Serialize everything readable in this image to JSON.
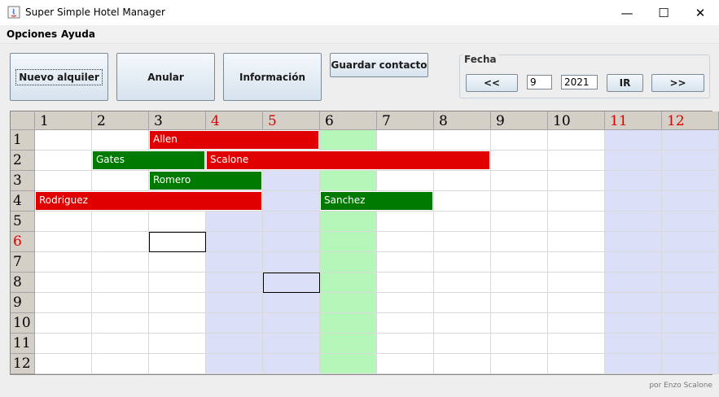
{
  "window": {
    "title": "Super Simple Hotel Manager",
    "minimize": "—",
    "maximize": "☐",
    "close": "✕"
  },
  "menu": {
    "items": [
      "Opciones",
      "Ayuda"
    ]
  },
  "toolbar": {
    "new_rental": "Nuevo alquiler",
    "cancel": "Anular",
    "info": "Información",
    "save_contact": "Guardar contacto"
  },
  "date": {
    "legend": "Fecha",
    "prev": "<<",
    "month": "9",
    "year": "2021",
    "go": "IR",
    "next": ">>"
  },
  "grid": {
    "days": [
      "1",
      "2",
      "3",
      "4",
      "5",
      "6",
      "7",
      "8",
      "9",
      "10",
      "11",
      "12"
    ],
    "weekend_days": [
      4,
      5,
      11,
      12
    ],
    "rooms": [
      "1",
      "2",
      "3",
      "4",
      "5",
      "6",
      "7",
      "8",
      "9",
      "10",
      "11",
      "12"
    ],
    "highlight_rooms": [
      6
    ],
    "today_day": 6,
    "colors": {
      "red": "#e00000",
      "green": "#007a00",
      "weekend": "#dcdff8",
      "today": "#b4f7b8",
      "header": "#d4d0c8"
    },
    "bookings": [
      {
        "room": 1,
        "start": 3,
        "end": 5,
        "name": "Allen",
        "color": "red"
      },
      {
        "room": 2,
        "start": 2,
        "end": 3,
        "name": "Gates",
        "color": "green"
      },
      {
        "room": 2,
        "start": 4,
        "end": 8,
        "name": "Scalone",
        "color": "red"
      },
      {
        "room": 3,
        "start": 3,
        "end": 4,
        "name": "Romero",
        "color": "green"
      },
      {
        "room": 4,
        "start": 1,
        "end": 4,
        "name": "Rodriguez",
        "color": "red"
      },
      {
        "room": 4,
        "start": 6,
        "end": 7,
        "name": "Sanchez",
        "color": "green"
      }
    ],
    "selected_cells": [
      {
        "room": 6,
        "day": 3
      },
      {
        "room": 8,
        "day": 5
      }
    ]
  },
  "footer": {
    "credit": "por Enzo Scalone"
  }
}
